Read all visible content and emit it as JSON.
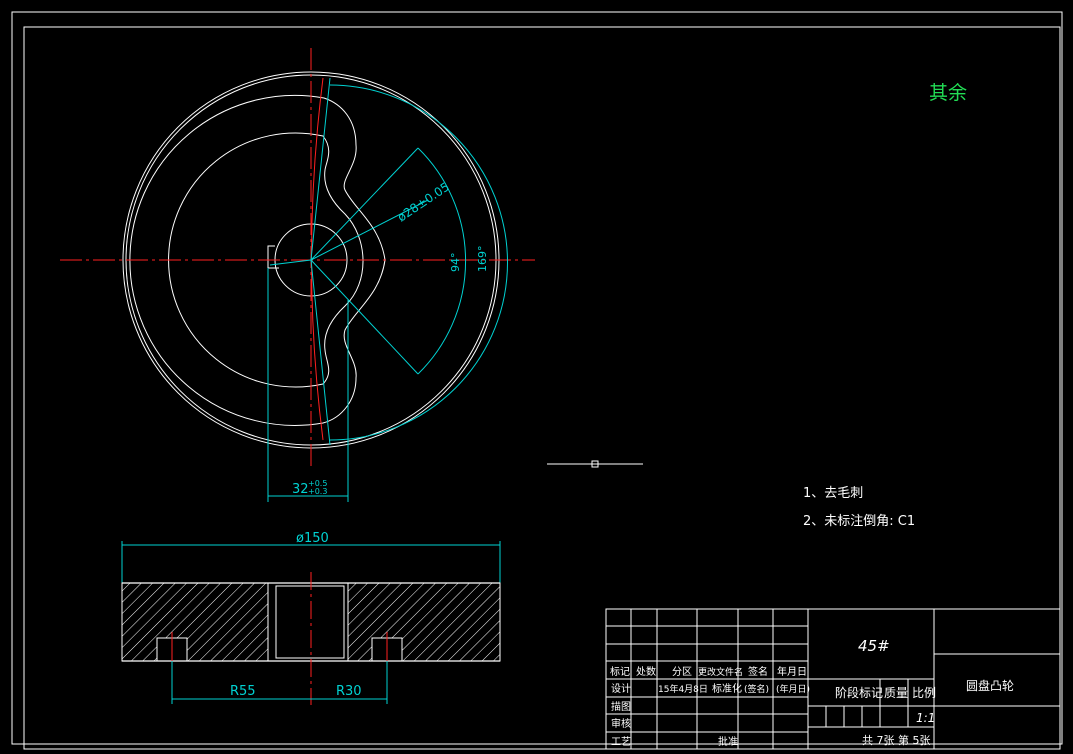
{
  "roughness_note": "其余",
  "dims": {
    "hub_dia": "ø28±0.05",
    "angle_small": "94°",
    "angle_large": "169°",
    "key_base": "32",
    "key_tol_up": "+0.5",
    "key_tol_dn": "+0.3",
    "outer_dia": "ø150",
    "r55": "R55",
    "r30": "R30"
  },
  "notes": [
    "1、去毛刺",
    "2、未标注倒角: C1"
  ],
  "title_block": {
    "material": "45#",
    "part_name": "圆盘凸轮",
    "scale": "1:1",
    "sheet_info": "共 7张 第 5张",
    "headers": [
      "标记",
      "处数",
      "分区",
      "更改文件名",
      "签名",
      "年月日"
    ],
    "row_design": [
      "设计",
      "15年4月8日",
      "标准化",
      "(签名)",
      "(年月日)"
    ],
    "row_labels": [
      "描图",
      "审核",
      "工艺"
    ],
    "approve": "批准",
    "stage_mark": "阶段标记",
    "weight": "质量",
    "ratio": "比例"
  },
  "colors": {
    "line": "#ffffff",
    "center": "#ff2020",
    "dim": "#00d2d2",
    "text_green": "#22dd55"
  }
}
